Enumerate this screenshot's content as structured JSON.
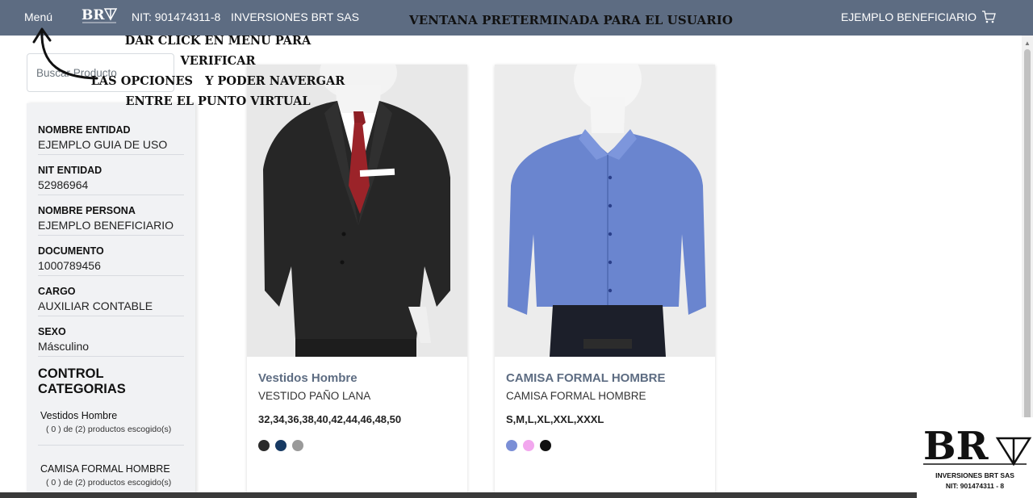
{
  "navbar": {
    "menu_label": "Menú",
    "nit": "NIT: 901474311-8",
    "company": "INVERSIONES BRT SAS",
    "banner": "VENTANA PRETERMINADA PARA EL USUARIO",
    "user": "EJEMPLO BENEFICIARIO",
    "logo_text": "BRT"
  },
  "annotation": {
    "line1": "DAR CLICK EN MENU PARA VERIFICAR",
    "line2": "LAS OPCIONES   Y PODER NAVERGAR",
    "line3": "ENTRE EL PUNTO VIRTUAL"
  },
  "search": {
    "placeholder": "Buscar Producto"
  },
  "info": {
    "fields": [
      {
        "label": "NOMBRE ENTIDAD",
        "value": "EJEMPLO GUIA DE USO"
      },
      {
        "label": "NIT ENTIDAD",
        "value": "52986964"
      },
      {
        "label": "NOMBRE PERSONA",
        "value": "EJEMPLO BENEFICIARIO"
      },
      {
        "label": "DOCUMENTO",
        "value": "1000789456"
      },
      {
        "label": "CARGO",
        "value": "AUXILIAR CONTABLE"
      },
      {
        "label": "SEXO",
        "value": "Másculino"
      }
    ],
    "categories_title": "CONTROL CATEGORIAS",
    "categories": [
      {
        "name": "Vestidos Hombre",
        "count": "( 0 ) de (2) productos escogido(s)"
      },
      {
        "name": "CAMISA FORMAL HOMBRE",
        "count": "( 0 ) de (2) productos escogido(s)"
      }
    ]
  },
  "products": [
    {
      "category": "Vestidos Hombre",
      "name": "VESTIDO PAÑO LANA",
      "sizes": "32,34,36,38,40,42,44,46,48,50",
      "colors": [
        "#2b2b2b",
        "#173a63",
        "#9a9a9a"
      ]
    },
    {
      "category": "CAMISA FORMAL HOMBRE",
      "name": "CAMISA FORMAL HOMBRE",
      "sizes": "S,M,L,XL,XXL,XXXL",
      "colors": [
        "#7b8fd6",
        "#f2a7ee",
        "#111111"
      ]
    }
  ],
  "brand": {
    "logo_text": "BRT",
    "name": "INVERSIONES BRT SAS",
    "nit": "NIT: 901474311 - 8"
  },
  "colors": {
    "navbar": "#5d6c82",
    "accent_text": "#5d6c82"
  }
}
